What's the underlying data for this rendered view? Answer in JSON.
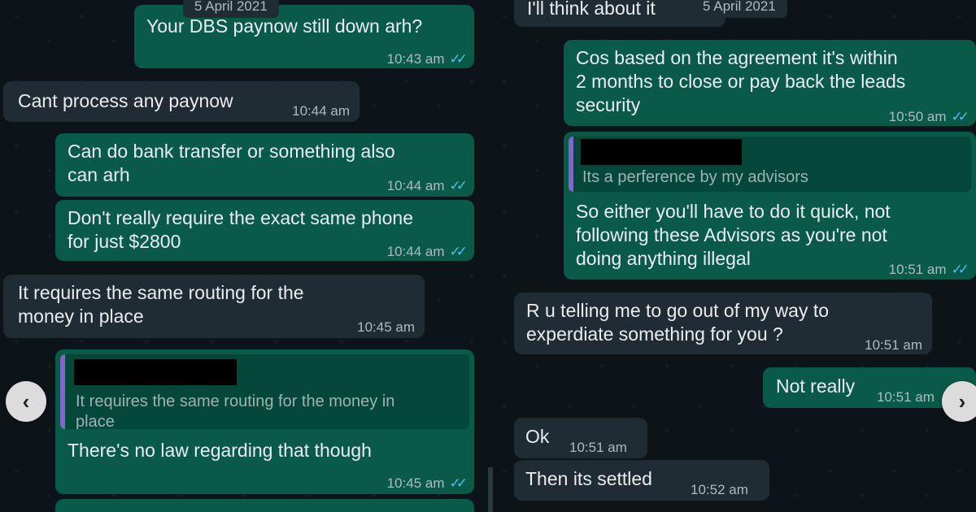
{
  "colors": {
    "outgoing": "#0a5a48",
    "incoming": "#1f2c34",
    "ticks": "#53bdeb",
    "background": "#0d1418"
  },
  "left": {
    "date_chip": "5 April 2021",
    "messages": [
      {
        "text": "Your DBS paynow still down arh?",
        "time": "10:43 am",
        "read": "✓✓"
      },
      {
        "text": "Cant process any paynow",
        "time": "10:44 am"
      },
      {
        "text": "Can do bank transfer or something also\ncan arh",
        "time": "10:44 am",
        "read": "✓✓"
      },
      {
        "text": "Don't really require the exact same phone\nfor just $2800",
        "time": "10:44 am",
        "read": "✓✓"
      },
      {
        "text": "It requires the same routing for the\nmoney in place",
        "time": "10:45 am"
      },
      {
        "quote": "It requires the same routing for the money in\nplace",
        "text": "There's no law regarding that though",
        "time": "10:45 am",
        "read": "✓✓"
      }
    ]
  },
  "right": {
    "date_chip": "5 April 2021",
    "messages": [
      {
        "text": "I'll think about it"
      },
      {
        "text": "Cos based on the agreement it's within\n2 months to close or pay back the leads\nsecurity",
        "time": "10:50 am",
        "read": "✓✓"
      },
      {
        "quote": "Its a perference by my advisors",
        "text": "So either you'll have to do it quick, not\nfollowing these Advisors as you're not\ndoing anything illegal",
        "time": "10:51 am",
        "read": "✓✓"
      },
      {
        "text": "R u telling me to go out of my way to\nexperdiate something for you ?",
        "time": "10:51 am"
      },
      {
        "text": "Not really",
        "time": "10:51 am"
      },
      {
        "text": "Ok",
        "time": "10:51 am"
      },
      {
        "text": "Then its settled",
        "time": "10:52 am"
      }
    ]
  },
  "nav": {
    "prev_icon": "‹",
    "next_icon": "›"
  }
}
